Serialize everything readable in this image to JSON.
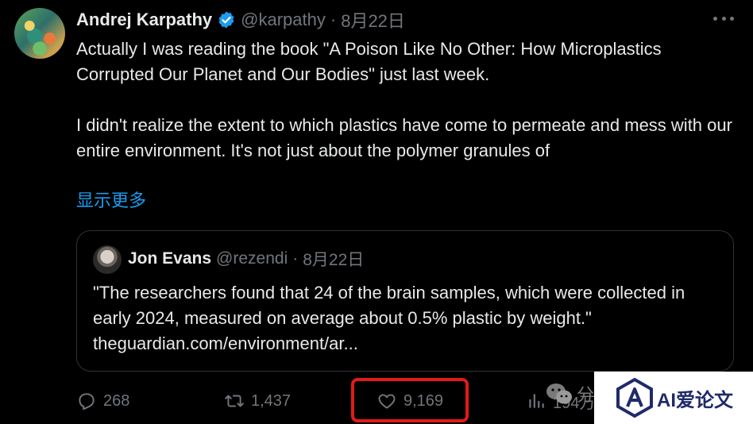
{
  "tweet": {
    "author_name": "Andrej Karpathy",
    "handle": "@karpathy",
    "separator": "·",
    "date": "8月22日",
    "text_para1": "Actually I was reading the book \"A Poison Like No Other: How Microplastics Corrupted Our Planet and Our Bodies\" just last week.",
    "text_para2": "I didn't realize the extent to which plastics have come to permeate and mess with our entire environment. It's not just about the polymer granules of",
    "show_more": "显示更多"
  },
  "quoted_tweet": {
    "author_name": "Jon Evans",
    "handle": "@rezendi",
    "separator": "·",
    "date": "8月22日",
    "text": "\"The researchers found that 24 of the brain samples, which were collected in early 2024, measured on average about 0.5% plastic by weight.\" theguardian.com/environment/ar..."
  },
  "actions": {
    "replies": "268",
    "reposts": "1,437",
    "likes": "9,169",
    "views": "194万"
  },
  "watermark": {
    "share_text": "分",
    "logo_text": "AI爱论文"
  },
  "colors": {
    "background": "#000000",
    "text": "#e7e9ea",
    "muted": "#71767b",
    "link": "#1d9bf0",
    "highlight": "#e21a1a"
  },
  "icons": [
    "verified-badge-icon",
    "more-icon",
    "reply-icon",
    "repost-icon",
    "like-icon",
    "views-icon",
    "wechat-icon",
    "logo-icon"
  ]
}
